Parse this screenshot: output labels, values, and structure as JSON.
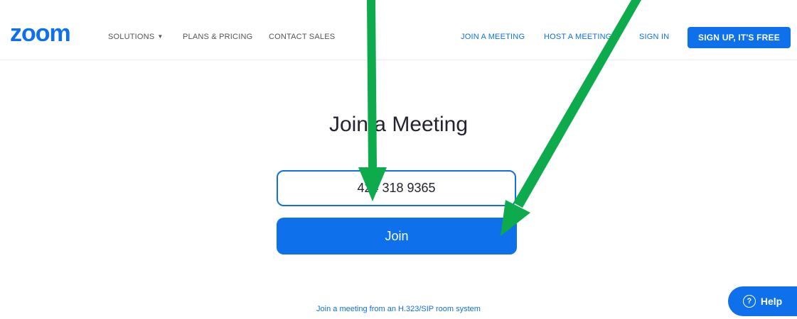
{
  "header": {
    "logo": "zoom",
    "nav": {
      "solutions": "SOLUTIONS",
      "plans_pricing": "PLANS & PRICING",
      "contact_sales": "CONTACT SALES",
      "join_meeting": "JOIN A MEETING",
      "host_meeting": "HOST A MEETING",
      "sign_in": "SIGN IN",
      "sign_up": "SIGN UP, IT'S FREE"
    }
  },
  "main": {
    "title": "Join a Meeting",
    "meeting_id_value": "424 318 9365",
    "join_label": "Join",
    "sip_link": "Join a meeting from an H.323/SIP room system"
  },
  "help": {
    "label": "Help",
    "icon_glyph": "?"
  },
  "colors": {
    "brand": "#0e71eb",
    "arrow": "#0dab4b"
  }
}
